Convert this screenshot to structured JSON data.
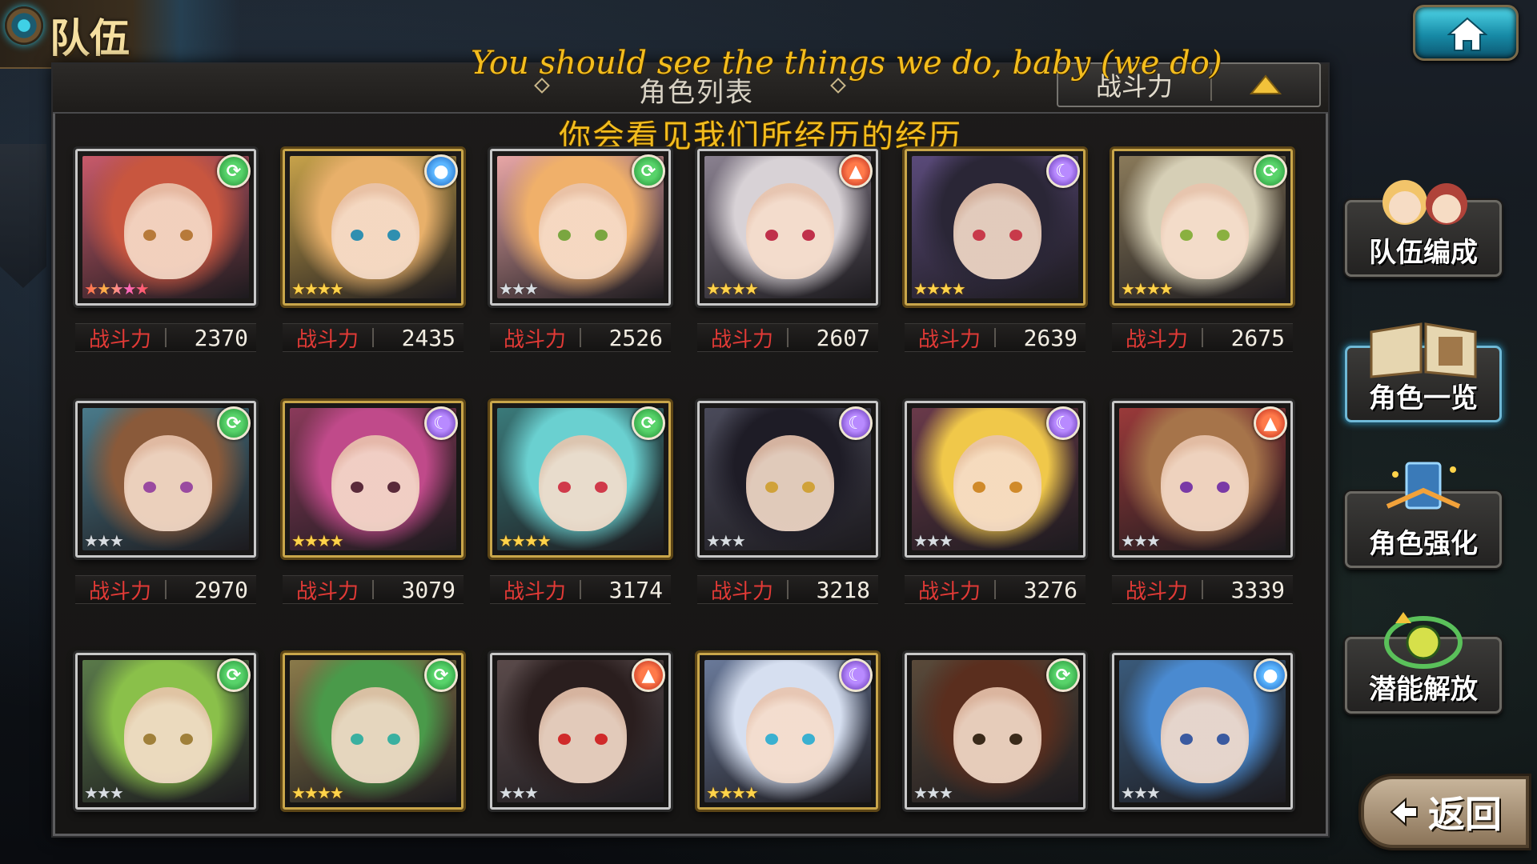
{
  "header": {
    "title": "队伍",
    "panel_title": "角色列表"
  },
  "sort": {
    "label": "战斗力",
    "direction_icon": "triangle-up-icon"
  },
  "lyrics": {
    "english": "You should see the things we do, baby (we do)",
    "chinese": "你会看见我们所经历的经历"
  },
  "power_label": "战斗力",
  "characters": [
    {
      "power": "2370",
      "element": "wind",
      "stars": "★★★★★",
      "star_tier": "rainbow",
      "frame": "silver",
      "bg": "#c85a6a",
      "hair": "#c8563f",
      "eye": "#b77a3a"
    },
    {
      "power": "2435",
      "element": "water",
      "stars": "★★★★",
      "star_tier": "gold",
      "frame": "gold",
      "bg": "#c7a24a",
      "hair": "#e8b06a",
      "eye": "#2f8fb0"
    },
    {
      "power": "2526",
      "element": "wind",
      "stars": "★★★",
      "star_tier": "silver",
      "frame": "silver",
      "bg": "#e8a6a6",
      "hair": "#f0b06a",
      "eye": "#7aa640"
    },
    {
      "power": "2607",
      "element": "fire",
      "stars": "★★★★",
      "star_tier": "gold",
      "frame": "silver",
      "bg": "#8a8190",
      "hair": "#d8d2d6",
      "eye": "#c0304a"
    },
    {
      "power": "2639",
      "element": "dark",
      "stars": "★★★★",
      "star_tier": "gold",
      "frame": "gold",
      "bg": "#5a4a7a",
      "hair": "#2a2636",
      "eye": "#c83a4a"
    },
    {
      "power": "2675",
      "element": "wind",
      "stars": "★★★★",
      "star_tier": "gold",
      "frame": "gold",
      "bg": "#8a7a5a",
      "hair": "#d6cfb6",
      "eye": "#8ab040"
    },
    {
      "power": "2970",
      "element": "wind",
      "stars": "★★★",
      "star_tier": "silver",
      "frame": "silver",
      "bg": "#4a7a8a",
      "hair": "#8a5a3a",
      "eye": "#9a4aa0"
    },
    {
      "power": "3079",
      "element": "dark",
      "stars": "★★★★",
      "star_tier": "gold",
      "frame": "gold",
      "bg": "#8a3a5a",
      "hair": "#c04a8a",
      "eye": "#5a2a3a"
    },
    {
      "power": "3174",
      "element": "wind",
      "stars": "★★★★",
      "star_tier": "gold",
      "frame": "gold",
      "bg": "#3a7a7a",
      "hair": "#6ad0d0",
      "eye": "#d03a4a"
    },
    {
      "power": "3218",
      "element": "dark",
      "stars": "★★★",
      "star_tier": "silver",
      "frame": "silver",
      "bg": "#4a4a5a",
      "hair": "#1e1c26",
      "eye": "#d0a23a"
    },
    {
      "power": "3276",
      "element": "dark",
      "stars": "★★★",
      "star_tier": "silver",
      "frame": "silver",
      "bg": "#6a3a4a",
      "hair": "#f0c84a",
      "eye": "#d08a2a"
    },
    {
      "power": "3339",
      "element": "fire",
      "stars": "★★★",
      "star_tier": "silver",
      "frame": "silver",
      "bg": "#9a3a3a",
      "hair": "#a6744a",
      "eye": "#7a3aa6"
    },
    {
      "power": "",
      "element": "wind",
      "stars": "★★★",
      "star_tier": "silver",
      "frame": "silver",
      "bg": "#5a7a4a",
      "hair": "#8ac04a",
      "eye": "#a0803a"
    },
    {
      "power": "",
      "element": "wind",
      "stars": "★★★★",
      "star_tier": "gold",
      "frame": "gold",
      "bg": "#8a7a4a",
      "hair": "#4a9a4a",
      "eye": "#3ab0a0"
    },
    {
      "power": "",
      "element": "fire",
      "stars": "★★★",
      "star_tier": "silver",
      "frame": "silver",
      "bg": "#5a4a4a",
      "hair": "#2a1e1e",
      "eye": "#d02a2a"
    },
    {
      "power": "",
      "element": "dark",
      "stars": "★★★★",
      "star_tier": "gold",
      "frame": "gold",
      "bg": "#6a7a9a",
      "hair": "#d6dff0",
      "eye": "#3ab0d0"
    },
    {
      "power": "",
      "element": "wind",
      "stars": "★★★",
      "star_tier": "silver",
      "frame": "silver",
      "bg": "#5a4a3a",
      "hair": "#5a2e1e",
      "eye": "#3a2a1a"
    },
    {
      "power": "",
      "element": "water",
      "stars": "★★★",
      "star_tier": "silver",
      "frame": "silver",
      "bg": "#3a5a7a",
      "hair": "#4a8ad0",
      "eye": "#3a5aa0"
    }
  ],
  "side_menu": [
    {
      "label": "队伍编成",
      "icon": "team-portrait-icon",
      "active": false
    },
    {
      "label": "角色一览",
      "icon": "book-icon",
      "active": true
    },
    {
      "label": "角色强化",
      "icon": "card-upgrade-icon",
      "active": false
    },
    {
      "label": "潜能解放",
      "icon": "potential-orb-icon",
      "active": false
    }
  ],
  "back": {
    "label": "返回",
    "icon": "arrow-left-icon"
  },
  "colors": {
    "power_label": "#e23a36",
    "lyric": "#f3bd1e",
    "accent_blue": "#2da6d0"
  }
}
